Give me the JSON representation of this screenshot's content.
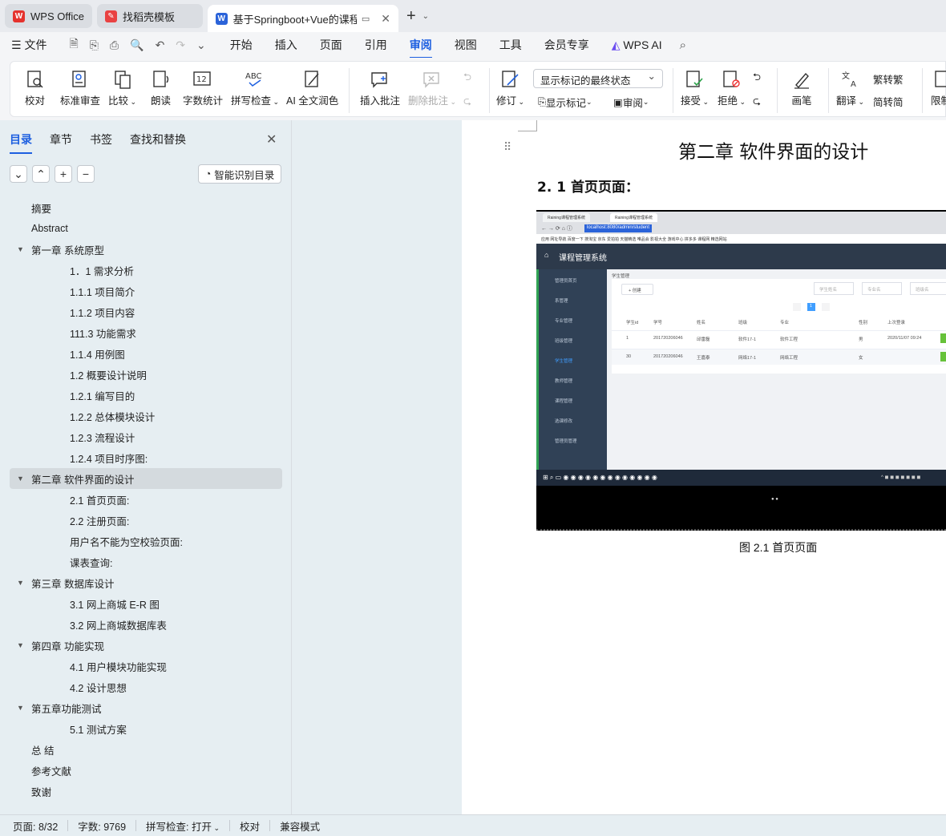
{
  "tabs": [
    {
      "label": "WPS Office",
      "icon": "wps-logo-icon",
      "color": "#e5322d"
    },
    {
      "label": "找稻壳模板",
      "icon": "docer-logo-icon",
      "color": "#e94242"
    },
    {
      "label": "基于Springboot+Vue的课程",
      "icon": "word-doc-icon",
      "color": "#2b63d9"
    }
  ],
  "menu": {
    "file": "文件",
    "items": [
      "开始",
      "插入",
      "页面",
      "引用",
      "审阅",
      "视图",
      "工具",
      "会员专享"
    ],
    "active": "审阅",
    "ai": "WPS AI"
  },
  "ribbon": {
    "proofread": "校对",
    "standard_review": "标准审查",
    "compare": "比较",
    "read_aloud": "朗读",
    "word_count": "字数统计",
    "spell_check": "拼写检查",
    "ai_polish": "AI 全文润色",
    "insert_comment": "插入批注",
    "delete_comment": "删除批注",
    "track": "修订",
    "display_mode": "显示标记的最终状态",
    "show_markup": "显示标记",
    "review_pane": "审阅",
    "accept": "接受",
    "reject": "拒绝",
    "pen": "画笔",
    "translate": "翻译",
    "to_traditional": "转繁",
    "to_simplified": "转简",
    "restrict": "限制"
  },
  "nav": {
    "tabs": [
      "目录",
      "章节",
      "书签",
      "查找和替换"
    ],
    "active_tab": "目录",
    "smart_btn": "智能识别目录",
    "toc": [
      {
        "label": "摘要",
        "level": 0
      },
      {
        "label": "Abstract",
        "level": 0
      },
      {
        "label": "第一章  系统原型",
        "level": 1
      },
      {
        "label": "1．1 需求分析",
        "level": 2
      },
      {
        "label": "1.1.1 项目简介",
        "level": 2
      },
      {
        "label": "1.1.2 项目内容",
        "level": 2
      },
      {
        "label": "111.3 功能需求",
        "level": 2
      },
      {
        "label": "1.1.4 用例图",
        "level": 2
      },
      {
        "label": "1.2  概要设计说明",
        "level": 2
      },
      {
        "label": "1.2.1 编写目的",
        "level": 2
      },
      {
        "label": "1.2.2 总体模块设计",
        "level": 2
      },
      {
        "label": "1.2.3 流程设计",
        "level": 2
      },
      {
        "label": "1.2.4 项目时序图:",
        "level": 2
      },
      {
        "label": "第二章  软件界面的设计",
        "level": 1,
        "selected": true
      },
      {
        "label": "2.1 首页页面:",
        "level": 2
      },
      {
        "label": "2.2 注册页面:",
        "level": 2
      },
      {
        "label": "用户名不能为空校验页面:",
        "level": 2
      },
      {
        "label": "课表查询:",
        "level": 2
      },
      {
        "label": "第三章  数据库设计",
        "level": 1
      },
      {
        "label": "3.1  网上商城 E-R 图",
        "level": 2
      },
      {
        "label": "3.2  网上商城数据库表",
        "level": 2
      },
      {
        "label": "第四章  功能实现",
        "level": 1
      },
      {
        "label": "4.1  用户模块功能实现",
        "level": 2
      },
      {
        "label": "4.2  设计思想",
        "level": 2
      },
      {
        "label": "第五章功能测试",
        "level": 1
      },
      {
        "label": "5.1 测试方案",
        "level": 2
      },
      {
        "label": "总  结",
        "level": 0
      },
      {
        "label": "参考文献",
        "level": 0
      },
      {
        "label": "致谢",
        "level": 0
      }
    ]
  },
  "document": {
    "chapter_title": "第二章  软件界面的设计",
    "section_title": "2. 1 首页页面：",
    "caption": "图 2.1  首页页面",
    "screenshot": {
      "browser_tab1": "Raining课程管理系统",
      "browser_tab2": "Raining课程管理系统",
      "url": "localhost:8080/admin/student",
      "bookmarks": "应用   网址导航   百度一下   搜淘宝   京东   爱拍拍   天猫精选   唯品会   影视大全   游戏中心   拼多多   课程网   精选网站",
      "app_title": "课程管理系统",
      "sidebar": [
        "管理员首页",
        "系管理",
        "专业管理",
        "班级管理",
        "学生管理",
        "教师管理",
        "课程管理",
        "选课修改",
        "管理员管理"
      ],
      "breadcrumb": "学生管理",
      "create_btn": "+ 创建",
      "search_placeholders": [
        "学生姓名",
        "专业名",
        "班级名"
      ],
      "page_num": "1",
      "columns": [
        "学生id",
        "学号",
        "姓名",
        "班级",
        "专业",
        "性别",
        "上次登录"
      ],
      "rows": [
        [
          "1",
          "201720206046",
          "邱雷磊",
          "软件17-1",
          "软件工程",
          "男",
          "2020/11/07 09:24"
        ],
        [
          "30",
          "201720206046",
          "王嘉泰",
          "网络17-1",
          "网络工程",
          "女",
          ""
        ]
      ]
    }
  },
  "status": {
    "page": "页面: 8/32",
    "words": "字数: 9769",
    "spell": "拼写检查: 打开",
    "proof": "校对",
    "compat": "兼容模式"
  }
}
